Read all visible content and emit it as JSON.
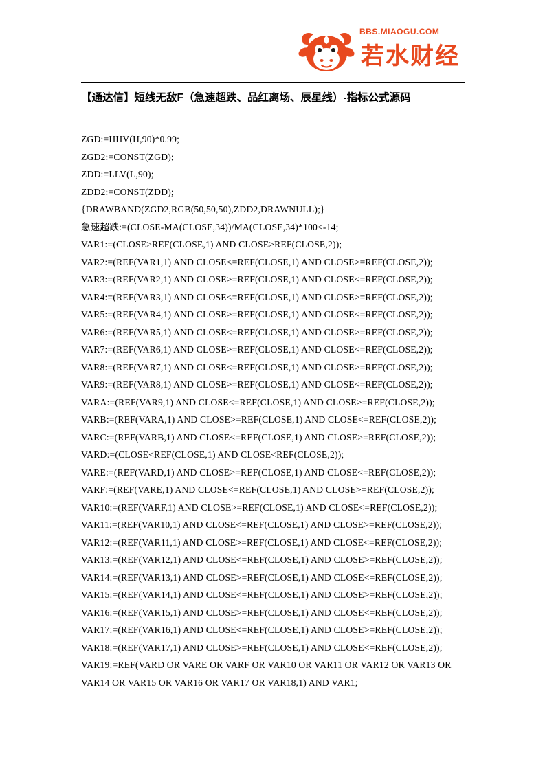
{
  "document": {
    "logo": {
      "name": "miaogu-caijing-logo",
      "top_text": "BBS.MIAOGU.COM",
      "brand_text": "若水财经",
      "bull_color": "#e8491f",
      "brand_color": "#e8491f",
      "top_text_color": "#e8491f"
    },
    "title": "【通达信】短线无敌F（急速超跌、品红离场、辰星线）-指标公式源码",
    "code_lines": [
      "ZGD:=HHV(H,90)*0.99;",
      "ZGD2:=CONST(ZGD);",
      "ZDD:=LLV(L,90);",
      "ZDD2:=CONST(ZDD);",
      "{DRAWBAND(ZGD2,RGB(50,50,50),ZDD2,DRAWNULL);}",
      "急速超跌:=(CLOSE-MA(CLOSE,34))/MA(CLOSE,34)*100<-14;",
      "VAR1:=(CLOSE>REF(CLOSE,1) AND CLOSE>REF(CLOSE,2));",
      "VAR2:=(REF(VAR1,1) AND CLOSE<=REF(CLOSE,1) AND CLOSE>=REF(CLOSE,2));",
      "VAR3:=(REF(VAR2,1) AND CLOSE>=REF(CLOSE,1) AND CLOSE<=REF(CLOSE,2));",
      "VAR4:=(REF(VAR3,1) AND CLOSE<=REF(CLOSE,1) AND CLOSE>=REF(CLOSE,2));",
      "VAR5:=(REF(VAR4,1) AND CLOSE>=REF(CLOSE,1) AND CLOSE<=REF(CLOSE,2));",
      "VAR6:=(REF(VAR5,1) AND CLOSE<=REF(CLOSE,1) AND CLOSE>=REF(CLOSE,2));",
      "VAR7:=(REF(VAR6,1) AND CLOSE>=REF(CLOSE,1) AND CLOSE<=REF(CLOSE,2));",
      "VAR8:=(REF(VAR7,1) AND CLOSE<=REF(CLOSE,1) AND CLOSE>=REF(CLOSE,2));",
      "VAR9:=(REF(VAR8,1) AND CLOSE>=REF(CLOSE,1) AND CLOSE<=REF(CLOSE,2));",
      "VARA:=(REF(VAR9,1) AND CLOSE<=REF(CLOSE,1) AND CLOSE>=REF(CLOSE,2));",
      "VARB:=(REF(VARA,1) AND CLOSE>=REF(CLOSE,1) AND CLOSE<=REF(CLOSE,2));",
      "VARC:=(REF(VARB,1) AND CLOSE<=REF(CLOSE,1) AND CLOSE>=REF(CLOSE,2));",
      "VARD:=(CLOSE<REF(CLOSE,1) AND CLOSE<REF(CLOSE,2));",
      "VARE:=(REF(VARD,1) AND CLOSE>=REF(CLOSE,1) AND CLOSE<=REF(CLOSE,2));",
      "VARF:=(REF(VARE,1) AND CLOSE<=REF(CLOSE,1) AND CLOSE>=REF(CLOSE,2));",
      "VAR10:=(REF(VARF,1) AND CLOSE>=REF(CLOSE,1) AND CLOSE<=REF(CLOSE,2));",
      "VAR11:=(REF(VAR10,1) AND CLOSE<=REF(CLOSE,1) AND CLOSE>=REF(CLOSE,2));",
      "VAR12:=(REF(VAR11,1) AND CLOSE>=REF(CLOSE,1) AND CLOSE<=REF(CLOSE,2));",
      "VAR13:=(REF(VAR12,1) AND CLOSE<=REF(CLOSE,1) AND CLOSE>=REF(CLOSE,2));",
      "VAR14:=(REF(VAR13,1) AND CLOSE>=REF(CLOSE,1) AND CLOSE<=REF(CLOSE,2));",
      "VAR15:=(REF(VAR14,1) AND CLOSE<=REF(CLOSE,1) AND CLOSE>=REF(CLOSE,2));",
      "VAR16:=(REF(VAR15,1) AND CLOSE>=REF(CLOSE,1) AND CLOSE<=REF(CLOSE,2));",
      "VAR17:=(REF(VAR16,1) AND CLOSE<=REF(CLOSE,1) AND CLOSE>=REF(CLOSE,2));",
      "VAR18:=(REF(VAR17,1) AND CLOSE>=REF(CLOSE,1) AND CLOSE<=REF(CLOSE,2));",
      "VAR19:=REF(VARD OR VARE OR VARF OR VAR10 OR VAR11 OR VAR12 OR VAR13 OR VAR14 OR VAR15 OR VAR16 OR VAR17 OR VAR18,1) AND VAR1;"
    ]
  }
}
